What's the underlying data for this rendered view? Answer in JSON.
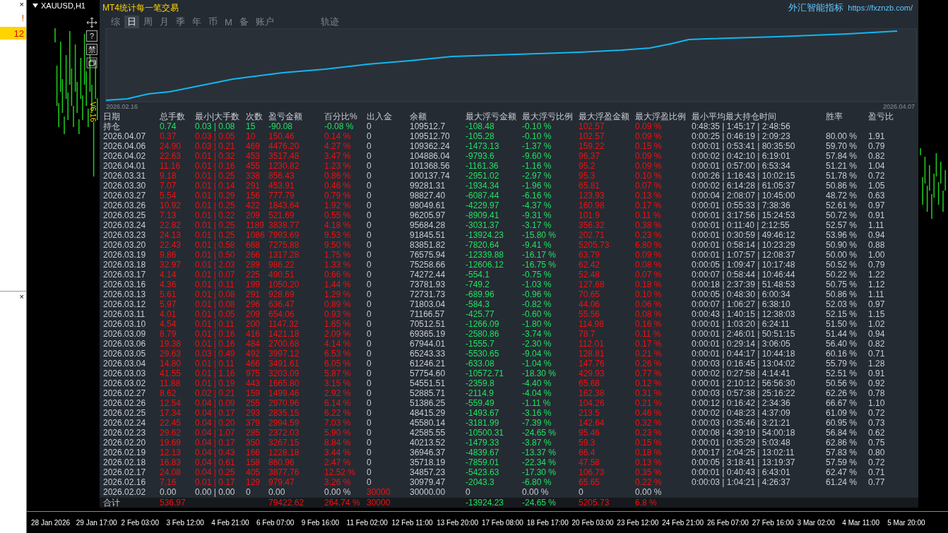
{
  "sidebar": {
    "close_buttons": [
      "×",
      "×"
    ],
    "rows": [
      {
        "value": "!",
        "selected": false
      },
      {
        "value": "12",
        "selected": true
      }
    ]
  },
  "chart_window": {
    "title": "XAUUSD,H1"
  },
  "side_toolbar": {
    "buttons": [
      "?",
      "禁"
    ],
    "version": "V6.16"
  },
  "panel": {
    "title": "MT4统计每一笔交易",
    "brand": "外汇智能指标",
    "link": "https://fxznzb.com/",
    "tabs": [
      {
        "label": "综",
        "selected": false
      },
      {
        "label": "日",
        "selected": true
      },
      {
        "label": "周",
        "selected": false
      },
      {
        "label": "月",
        "selected": false
      },
      {
        "label": "季",
        "selected": false
      },
      {
        "label": "年",
        "selected": false
      },
      {
        "label": "币",
        "selected": false
      },
      {
        "label": "M",
        "selected": false
      },
      {
        "label": "备",
        "selected": false
      },
      {
        "label": "账户",
        "selected": false
      }
    ],
    "extra_tab": {
      "label": "轨迹",
      "selected": false
    },
    "equity_chart": {
      "start_label": "2026.02.16",
      "end_label": "2026.04.07"
    },
    "columns": [
      "日期",
      "总手数",
      "最小|大手数",
      "次数",
      "盈亏金额",
      "百分比%",
      "出入金",
      "余额",
      "最大浮亏金额",
      "最大浮亏比例",
      "最大浮盈金额",
      "最大浮盈比例",
      "最小平均最大持仓时间",
      "胜率",
      "盈亏比"
    ],
    "rows": [
      {
        "kind": "open",
        "cells": [
          "持仓",
          "0.74",
          "0.03 | 0.08",
          "15",
          "-90.08",
          "-0.08 %",
          "0",
          "109512.7",
          "-108.48",
          "-0.10 %",
          "102.57",
          "0.09 %",
          "0:48:35 | 1:45:17 | 2:48:56"
        ]
      },
      {
        "kind": "day",
        "cells": [
          "2026.04.07",
          "0.37",
          "0.03 | 0.05",
          "10",
          "150.46",
          "0.14 %",
          "0",
          "109512.70",
          "-105.28",
          "-0.10 %",
          "102.57",
          "0.09 %",
          "0:00:25 | 0:46:19 | 2:09:23",
          "80.00 %",
          "1.91"
        ]
      },
      {
        "kind": "day",
        "cells": [
          "2026.04.06",
          "24.90",
          "0.03 | 0.21",
          "469",
          "4476.20",
          "4.27 %",
          "0",
          "109362.24",
          "-1473.13",
          "-1.37 %",
          "159.22",
          "0.15 %",
          "0:00:01 | 0:53:41 | 80:35:50",
          "59.70 %",
          "0.79"
        ]
      },
      {
        "kind": "day",
        "cells": [
          "2026.04.02",
          "22.63",
          "0.01 | 0.32",
          "453",
          "3517.48",
          "3.47 %",
          "0",
          "104886.04",
          "-9793.6",
          "-9.60 %",
          "96.37",
          "0.09 %",
          "0:00:02 | 0:42:10 | 6:19:01",
          "57.84 %",
          "0.82"
        ]
      },
      {
        "kind": "day",
        "cells": [
          "2026.04.01",
          "11.16",
          "0.01 | 0.16",
          "455",
          "1230.82",
          "1.23 %",
          "0",
          "101368.56",
          "-1161.36",
          "-1.16 %",
          "95.2",
          "0.09 %",
          "0:00:01 | 0:57:00 | 6:53:34",
          "51.21 %",
          "1.04"
        ]
      },
      {
        "kind": "day",
        "cells": [
          "2026.03.31",
          "9.18",
          "0.01 | 0.25",
          "338",
          "856.43",
          "0.86 %",
          "0",
          "100137.74",
          "-2951.02",
          "-2.97 %",
          "95.3",
          "0.10 %",
          "0:00:26 | 1:16:43 | 10:02:15",
          "51.78 %",
          "0.72"
        ]
      },
      {
        "kind": "day",
        "cells": [
          "2026.03.30",
          "7.07",
          "0.01 | 0.14",
          "291",
          "453.91",
          "0.46 %",
          "0",
          "99281.31",
          "-1934.34",
          "-1.96 %",
          "65.81",
          "0.07 %",
          "0:00:02 | 6:14:28 | 61:05:37",
          "50.86 %",
          "1.05"
        ]
      },
      {
        "kind": "day",
        "cells": [
          "2026.03.27",
          "5.54",
          "0.01 | 0.29",
          "156",
          "777.79",
          "0.79 %",
          "0",
          "98827.40",
          "-6087.44",
          "-6.16 %",
          "123.93",
          "0.13 %",
          "0:00:04 | 2:08:07 | 10:45:00",
          "48.72 %",
          "0.63"
        ]
      },
      {
        "kind": "day",
        "cells": [
          "2026.03.26",
          "10.92",
          "0.01 | 0.25",
          "422",
          "1843.64",
          "1.92 %",
          "0",
          "98049.61",
          "-4229.97",
          "-4.37 %",
          "160.98",
          "0.17 %",
          "0:00:01 | 0:55:33 | 7:38:36",
          "52.61 %",
          "0.97"
        ]
      },
      {
        "kind": "day",
        "cells": [
          "2026.03.25",
          "7.13",
          "0.01 | 0.22",
          "209",
          "521.69",
          "0.55 %",
          "0",
          "96205.97",
          "-8909.41",
          "-9.31 %",
          "101.9",
          "0.11 %",
          "0:00:01 | 3:17:56 | 15:24:53",
          "50.72 %",
          "0.91"
        ]
      },
      {
        "kind": "day",
        "cells": [
          "2026.03.24",
          "22.82",
          "0.01 | 0.25",
          "1189",
          "3838.77",
          "4.18 %",
          "0",
          "95684.28",
          "-3031.37",
          "-3.17 %",
          "356.32",
          "0.38 %",
          "0:00:01 | 0:11:40 | 2:12:55",
          "52.57 %",
          "1.11"
        ]
      },
      {
        "kind": "day",
        "cells": [
          "2026.03.23",
          "24.13",
          "0.01 | 0.25",
          "1086",
          "7993.69",
          "9.53 %",
          "0",
          "91845.51",
          "-13924.23",
          "-15.80 %",
          "202.71",
          "0.23 %",
          "0:00:01 | 0:30:59 | 49:46:12",
          "53.96 %",
          "0.94"
        ]
      },
      {
        "kind": "day",
        "cells": [
          "2026.03.20",
          "22.43",
          "0.01 | 0.58",
          "668",
          "7275.88",
          "9.50 %",
          "0",
          "83851.82",
          "-7820.64",
          "-9.41 %",
          "5205.73",
          "6.80 %",
          "0:00:01 | 0:58:14 | 10:23:29",
          "50.90 %",
          "0.88"
        ]
      },
      {
        "kind": "day",
        "cells": [
          "2026.03.19",
          "9.86",
          "0.01 | 0.50",
          "266",
          "1317.28",
          "1.75 %",
          "0",
          "76575.94",
          "-12339.88",
          "-16.17 %",
          "63.79",
          "0.09 %",
          "0:00:01 | 1:07:57 | 12:08:37",
          "50.00 %",
          "1.00"
        ]
      },
      {
        "kind": "day",
        "cells": [
          "2026.03.18",
          "32.97",
          "0.01 | 2.03",
          "289",
          "986.22",
          "1.33 %",
          "0",
          "75258.66",
          "-12606.12",
          "-16.75 %",
          "62.42",
          "0.08 %",
          "0:00:05 | 1:09:47 | 10:17:48",
          "50.52 %",
          "0.79"
        ]
      },
      {
        "kind": "day",
        "cells": [
          "2026.03.17",
          "4.14",
          "0.01 | 0.07",
          "225",
          "490.51",
          "0.66 %",
          "0",
          "74272.44",
          "-554.1",
          "-0.75 %",
          "52.48",
          "0.07 %",
          "0:00:07 | 0:58:44 | 10:46:44",
          "50.22 %",
          "1.22"
        ]
      },
      {
        "kind": "day",
        "cells": [
          "2026.03.16",
          "4.36",
          "0.01 | 0.11",
          "199",
          "1050.20",
          "1.44 %",
          "0",
          "73781.93",
          "-749.2",
          "-1.03 %",
          "127.68",
          "0.18 %",
          "0:00:18 | 2:37:39 | 51:48:53",
          "50.75 %",
          "1.12"
        ]
      },
      {
        "kind": "day",
        "cells": [
          "2026.03.13",
          "5.61",
          "0.01 | 0.08",
          "291",
          "928.69",
          "1.29 %",
          "0",
          "72731.73",
          "-689.96",
          "-0.96 %",
          "70.65",
          "0.10 %",
          "0:00:05 | 0:48:30 | 6:00:34",
          "50.86 %",
          "1.11"
        ]
      },
      {
        "kind": "day",
        "cells": [
          "2026.03.12",
          "5.97",
          "0.01 | 0.08",
          "296",
          "636.47",
          "0.89 %",
          "0",
          "71803.04",
          "-584.3",
          "-0.82 %",
          "44.06",
          "0.06 %",
          "0:00:07 | 1:06:27 | 6:38:10",
          "52.03 %",
          "0.97"
        ]
      },
      {
        "kind": "day",
        "cells": [
          "2026.03.11",
          "4.01",
          "0.01 | 0.05",
          "209",
          "654.06",
          "0.93 %",
          "0",
          "71166.57",
          "-425.77",
          "-0.60 %",
          "55.56",
          "0.08 %",
          "0:00:43 | 1:40:15 | 12:38:03",
          "52.15 %",
          "1.15"
        ]
      },
      {
        "kind": "day",
        "cells": [
          "2026.03.10",
          "4.54",
          "0.01 | 0.11",
          "200",
          "1147.32",
          "1.65 %",
          "0",
          "70512.51",
          "-1266.09",
          "-1.80 %",
          "114.98",
          "0.16 %",
          "0:00:01 | 1:03:20 | 6:24:11",
          "51.50 %",
          "1.02"
        ]
      },
      {
        "kind": "day",
        "cells": [
          "2026.03.09",
          "8.79",
          "0.01 | 0.16",
          "416",
          "1421.18",
          "2.09 %",
          "0",
          "69365.19",
          "-2580.86",
          "-3.74 %",
          "78.7",
          "0.11 %",
          "0:00:01 | 2:46:01 | 50:51:15",
          "51.44 %",
          "0.94"
        ]
      },
      {
        "kind": "day",
        "cells": [
          "2026.03.06",
          "19.38",
          "0.01 | 0.16",
          "484",
          "2700.68",
          "4.14 %",
          "0",
          "67944.01",
          "-1555.7",
          "-2.30 %",
          "112.01",
          "0.17 %",
          "0:00:01 | 0:29:14 | 3:06:05",
          "56.40 %",
          "0.82"
        ]
      },
      {
        "kind": "day",
        "cells": [
          "2026.03.05",
          "29.63",
          "0.03 | 0.49",
          "492",
          "3997.12",
          "6.53 %",
          "0",
          "65243.33",
          "-5530.65",
          "-9.04 %",
          "128.81",
          "0.21 %",
          "0:00:01 | 0:44:17 | 10:44:18",
          "60.16 %",
          "0.71"
        ]
      },
      {
        "kind": "day",
        "cells": [
          "2026.03.04",
          "14.80",
          "0.01 | 0.11",
          "466",
          "3491.61",
          "6.05 %",
          "0",
          "61246.21",
          "-633.08",
          "-1.04 %",
          "147.76",
          "0.26 %",
          "0:00:03 | 0:16:45 | 13:04:02",
          "55.79 %",
          "1.28"
        ]
      },
      {
        "kind": "day",
        "cells": [
          "2026.03.03",
          "41.55",
          "0.01 | 1.16",
          "975",
          "3203.09",
          "5.87 %",
          "0",
          "57754.60",
          "-10572.71",
          "-18.30 %",
          "429.93",
          "0.77 %",
          "0:00:02 | 0:27:58 | 4:14:41",
          "52.51 %",
          "0.91"
        ]
      },
      {
        "kind": "day",
        "cells": [
          "2026.03.02",
          "11.88",
          "0.01 | 0.19",
          "443",
          "1665.80",
          "3.15 %",
          "0",
          "54551.51",
          "-2359.8",
          "-4.40 %",
          "65.68",
          "0.12 %",
          "0:00:01 | 2:10:12 | 56:56:30",
          "50.56 %",
          "0.92"
        ]
      },
      {
        "kind": "day",
        "cells": [
          "2026.02.27",
          "8.62",
          "0.02 | 0.21",
          "159",
          "1499.46",
          "2.92 %",
          "0",
          "52885.71",
          "-2114.9",
          "-4.04 %",
          "162.38",
          "0.31 %",
          "0:00:03 | 0:57:38 | 25:16:22",
          "62.26 %",
          "0.78"
        ]
      },
      {
        "kind": "day",
        "cells": [
          "2026.02.26",
          "12.54",
          "0.04 | 0.09",
          "255",
          "2970.96",
          "6.14 %",
          "0",
          "51386.25",
          "-559.49",
          "-1.11 %",
          "104.26",
          "0.21 %",
          "0:00:12 | 0:16:42 | 2:34:36",
          "66.67 %",
          "1.10"
        ]
      },
      {
        "kind": "day",
        "cells": [
          "2026.02.25",
          "17.34",
          "0.04 | 0.17",
          "293",
          "2835.15",
          "6.22 %",
          "0",
          "48415.29",
          "-1493.67",
          "-3.16 %",
          "213.5",
          "0.46 %",
          "0:00:02 | 0:48:23 | 4:37:09",
          "61.09 %",
          "0.72"
        ]
      },
      {
        "kind": "day",
        "cells": [
          "2026.02.24",
          "22.45",
          "0.04 | 0.20",
          "379",
          "2994.59",
          "7.03 %",
          "0",
          "45580.14",
          "-3181.99",
          "-7.39 %",
          "142.64",
          "0.32 %",
          "0:00:03 | 0:35:46 | 3:21:21",
          "60.95 %",
          "0.73"
        ]
      },
      {
        "kind": "day",
        "cells": [
          "2026.02.23",
          "29.62",
          "0.04 | 1.07",
          "285",
          "2372.03",
          "5.90 %",
          "0",
          "42585.55",
          "-10500.31",
          "-24.65 %",
          "95.46",
          "0.23 %",
          "0:00:08 | 4:39:19 | 54:00:18",
          "56.84 %",
          "0.62"
        ]
      },
      {
        "kind": "day",
        "cells": [
          "2026.02.20",
          "19.69",
          "0.04 | 0.17",
          "350",
          "3267.15",
          "8.84 %",
          "0",
          "40213.52",
          "-1479.33",
          "-3.87 %",
          "59.3",
          "0.15 %",
          "0:00:01 | 0:35:29 | 5:03:48",
          "62.86 %",
          "0.75"
        ]
      },
      {
        "kind": "day",
        "cells": [
          "2026.02.19",
          "12.13",
          "0.04 | 0.43",
          "166",
          "1228.18",
          "3.44 %",
          "0",
          "36946.37",
          "-4839.67",
          "-13.37 %",
          "66.4",
          "0.18 %",
          "0:00:17 | 2:04:25 | 13:02:11",
          "57.83 %",
          "0.80"
        ]
      },
      {
        "kind": "day",
        "cells": [
          "2026.02.18",
          "16.83",
          "0.04 | 0.61",
          "158",
          "860.96",
          "2.47 %",
          "0",
          "35718.19",
          "-7859.01",
          "-22.34 %",
          "47.58",
          "0.13 %",
          "0:00:05 | 3:18:41 | 13:19:37",
          "57.59 %",
          "0.72"
        ]
      },
      {
        "kind": "day",
        "cells": [
          "2026.02.17",
          "24.08",
          "0.04 | 0.25",
          "405",
          "3877.76",
          "12.52 %",
          "0",
          "34857.23",
          "-5423.63",
          "-17.30 %",
          "106.73",
          "0.35 %",
          "0:00:01 | 0:40:43 | 6:43:01",
          "62.47 %",
          "0.71"
        ]
      },
      {
        "kind": "day",
        "cells": [
          "2026.02.16",
          "7.16",
          "0.01 | 0.17",
          "129",
          "979.47",
          "3.26 %",
          "0",
          "30979.47",
          "-2043.3",
          "-6.80 %",
          "65.65",
          "0.22 %",
          "0:00:03 | 1:04:21 | 4:26:37",
          "61.24 %",
          "0.77"
        ]
      },
      {
        "kind": "deposit",
        "cells": [
          "2026.02.02",
          "0.00",
          "0.00 | 0.00",
          "0",
          "0.00",
          "0.00 %",
          "30000",
          "30000.00",
          "0",
          "0.00 %",
          "0",
          "0.00 %"
        ]
      },
      {
        "kind": "total",
        "cells": [
          "合计",
          "536.97",
          null,
          null,
          "79422.62",
          "264.74 %",
          "30000",
          null,
          "-13924.23",
          "-24.65 %",
          "5205.73",
          "6.8 %"
        ]
      }
    ]
  },
  "time_axis": [
    "28 Jan 2026",
    "29 Jan 17:00",
    "2 Feb 03:00",
    "3 Feb 12:00",
    "4 Feb 21:00",
    "6 Feb 07:00",
    "9 Feb 16:00",
    "11 Feb 02:00",
    "12 Feb 11:00",
    "13 Feb 20:00",
    "17 Feb 08:00",
    "18 Feb 17:00",
    "20 Feb 03:00",
    "23 Feb 12:00",
    "24 Feb 21:00",
    "26 Feb 07:00",
    "27 Feb 16:00",
    "3 Mar 02:00",
    "4 Mar 11:00",
    "5 Mar 20:00"
  ]
}
